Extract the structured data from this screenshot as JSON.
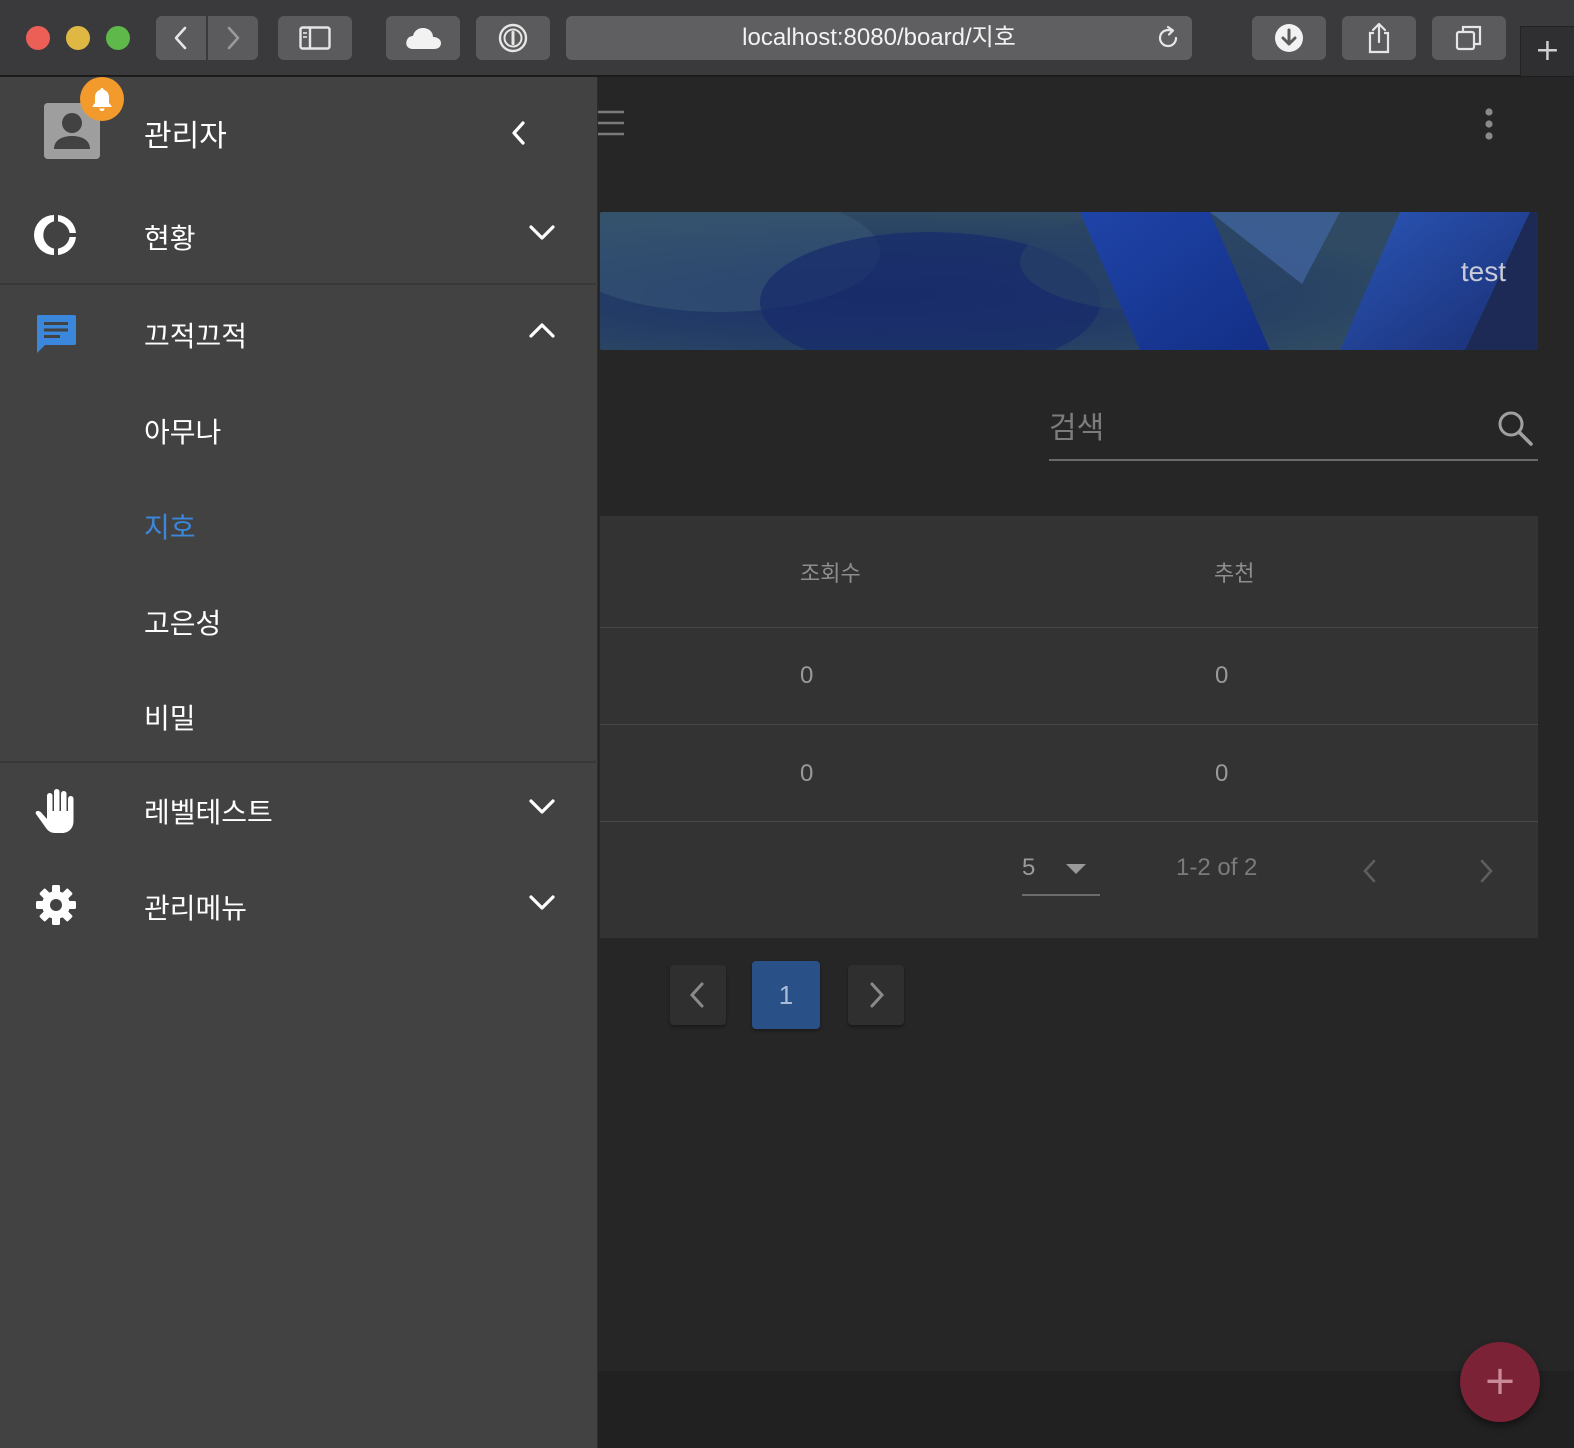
{
  "browser": {
    "url": "localhost:8080/board/지호",
    "new_tab": "+"
  },
  "drawer": {
    "user_name": "관리자",
    "menu": [
      {
        "label": "현황",
        "icon": "donut-chart-icon",
        "expanded": false
      },
      {
        "label": "끄적끄적",
        "icon": "chat-message-icon",
        "expanded": true,
        "children": [
          {
            "label": "아무나",
            "active": false
          },
          {
            "label": "지호",
            "active": true
          },
          {
            "label": "고은성",
            "active": false
          },
          {
            "label": "비밀",
            "active": false
          }
        ]
      },
      {
        "label": "레벨테스트",
        "icon": "hand-icon",
        "expanded": false
      },
      {
        "label": "관리메뉴",
        "icon": "gear-icon",
        "expanded": false
      }
    ]
  },
  "main": {
    "banner_text": "test",
    "search_placeholder": "검색",
    "table": {
      "headers": [
        "조회수",
        "추천"
      ],
      "rows": [
        [
          "0",
          "0"
        ],
        [
          "0",
          "0"
        ]
      ],
      "rows_per_page": "5",
      "range_text": "1-2 of 2"
    },
    "pagination": {
      "current_page": "1"
    },
    "fab_label": "+"
  },
  "colors": {
    "drawer_bg": "#424242",
    "active_accent": "#3b87db",
    "badge": "#f39a2c",
    "fab": "#7c2237"
  }
}
